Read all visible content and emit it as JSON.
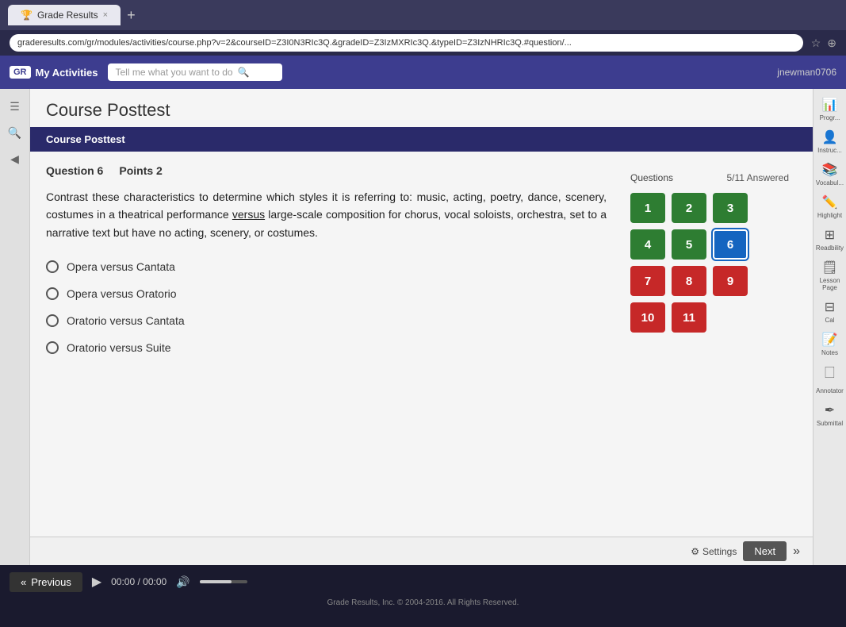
{
  "browser": {
    "tab_title": "Grade Results",
    "tab_close": "×",
    "tab_add": "+",
    "url": "graderesults.com/gr/modules/activities/course.php?v=2&courseID=Z3I0N3RIc3Q.&gradeID=Z3IzMXRIc3Q.&typeID=Z3IzNHRIc3Q.#question/...",
    "star_icon": "☆",
    "bookmark_icon": "⊕"
  },
  "app_header": {
    "logo_text": "My Activities",
    "logo_icon": "GR",
    "search_placeholder": "Tell me what you want to do",
    "search_icon": "🔍",
    "username": "jnewman0706"
  },
  "page": {
    "title": "Course Posttest",
    "section": "Course Posttest"
  },
  "question": {
    "number": "Question 6",
    "points": "Points 2",
    "text": "Contrast these characteristics to determine which styles it is referring to: music, acting, poetry, dance, scenery, costumes in a theatrical performance versus large-scale composition for chorus, vocal soloists, orchestra, set to a narrative text but have no acting, scenery, or costumes.",
    "underlined_word": "versus",
    "options": [
      "Opera versus Cantata",
      "Opera versus Oratorio",
      "Oratorio versus Cantata",
      "Oratorio versus Suite"
    ]
  },
  "question_panel": {
    "label": "Questions",
    "answered": "5/11 Answered",
    "buttons": [
      {
        "num": "1",
        "state": "green"
      },
      {
        "num": "2",
        "state": "green"
      },
      {
        "num": "3",
        "state": "green"
      },
      {
        "num": "4",
        "state": "green"
      },
      {
        "num": "5",
        "state": "green"
      },
      {
        "num": "6",
        "state": "current"
      },
      {
        "num": "7",
        "state": "red"
      },
      {
        "num": "8",
        "state": "red"
      },
      {
        "num": "9",
        "state": "red"
      },
      {
        "num": "10",
        "state": "red"
      },
      {
        "num": "11",
        "state": "red"
      }
    ]
  },
  "right_sidebar": [
    {
      "icon": "📊",
      "label": "Progress"
    },
    {
      "icon": "🖼",
      "label": "Instructor"
    },
    {
      "icon": "📚",
      "label": "Vocabulary"
    },
    {
      "icon": "✏️",
      "label": "Highlight"
    },
    {
      "icon": "⚏",
      "label": "Readability"
    },
    {
      "icon": "📋",
      "label": "Lesson Page"
    },
    {
      "icon": "⊞",
      "label": "Cal"
    },
    {
      "icon": "📝",
      "label": "Notes"
    },
    {
      "icon": "🔲",
      "label": "Annotator"
    },
    {
      "icon": "✏",
      "label": "Submittal"
    }
  ],
  "bottom_bar": {
    "settings_label": "Settings",
    "next_label": "Next",
    "arrow_label": "»"
  },
  "media_bar": {
    "prev_arrow": "«",
    "prev_label": "Previous",
    "play_icon": "▶",
    "time": "00:00 / 00:00",
    "volume_icon": "🔊"
  },
  "footer": {
    "text": "Grade Results, Inc. © 2004-2016. All Rights Reserved."
  }
}
